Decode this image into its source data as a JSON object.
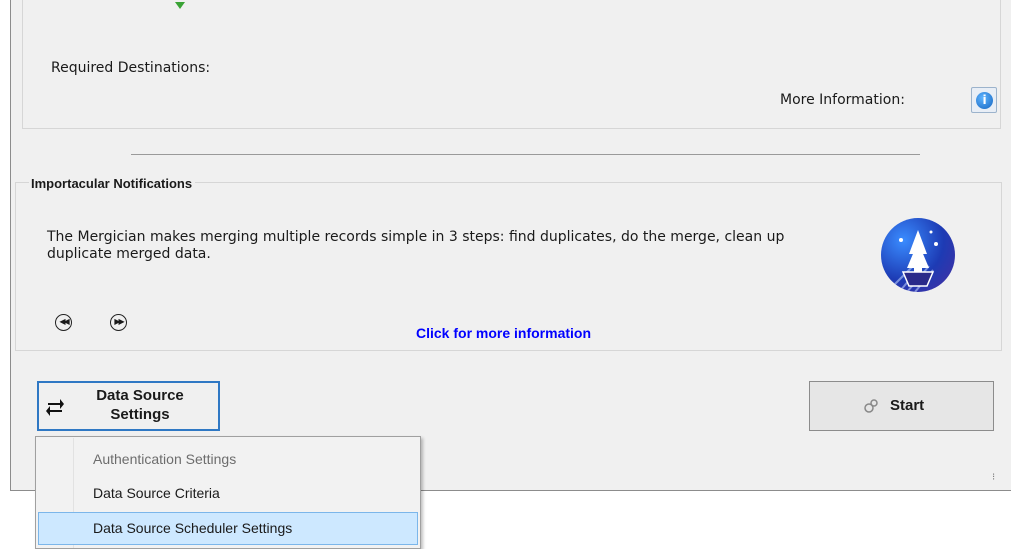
{
  "destinations": {
    "required_label": "Required Destinations:",
    "more_info_label": "More Information:",
    "info_glyph": "i"
  },
  "notifications": {
    "title": "Importacular Notifications",
    "message": "The Mergician makes merging multiple records simple in 3 steps: find duplicates, do the merge, clean up duplicate merged data.",
    "link": "Click for more information",
    "prev_glyph": "◀◀",
    "next_glyph": "▶▶"
  },
  "toolbar": {
    "data_source_label_line1": "Data Source",
    "data_source_label_line2": "Settings",
    "start_label": "Start"
  },
  "menu": {
    "items": [
      {
        "label": "Authentication Settings",
        "enabled": false
      },
      {
        "label": "Data Source Criteria",
        "enabled": true
      },
      {
        "label": "Data Source Scheduler Settings",
        "enabled": true,
        "selected": true
      }
    ]
  },
  "colors": {
    "link": "#0000ff",
    "focus_border": "#2f78c4",
    "menu_highlight": "#cde8ff",
    "window_bg": "#f0f0f0"
  },
  "icons": {
    "info": "info-icon",
    "wizard": "magic-hat-icon",
    "sync": "sync-arrows-icon",
    "start": "gear-link-icon"
  }
}
